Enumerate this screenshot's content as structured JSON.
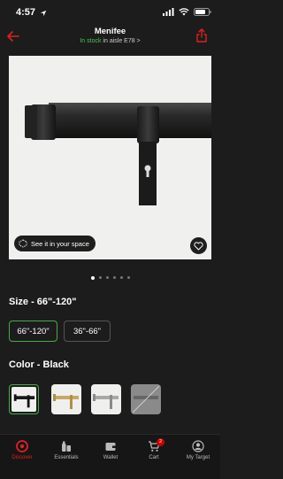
{
  "status_bar": {
    "time": "4:57"
  },
  "header": {
    "store_name": "Menifee",
    "stock_status": "In stock",
    "aisle": "in aisle E78 >"
  },
  "product_image": {
    "see_in_space_label": "See it in your space",
    "carousel_pages": 6,
    "active_page": 1
  },
  "size": {
    "title": "Size - 66\"-120\"",
    "options": [
      {
        "label": "66\"-120\"",
        "selected": true
      },
      {
        "label": "36\"-66\"",
        "selected": false
      }
    ]
  },
  "color": {
    "title": "Color - Black",
    "swatches": [
      {
        "name": "black",
        "selected": true
      },
      {
        "name": "gold",
        "selected": false
      },
      {
        "name": "silver",
        "selected": false
      },
      {
        "name": "gray-unavailable",
        "selected": false
      }
    ]
  },
  "tab_bar": {
    "tabs": [
      {
        "label": "Discover",
        "icon": "target-logo-icon",
        "active": true
      },
      {
        "label": "Essentials",
        "icon": "essentials-icon",
        "active": false
      },
      {
        "label": "Wallet",
        "icon": "wallet-icon",
        "active": false
      },
      {
        "label": "Cart",
        "icon": "cart-icon",
        "active": false
      },
      {
        "label": "My Target",
        "icon": "profile-icon",
        "active": false
      }
    ],
    "cart_count": "2"
  },
  "colors": {
    "accent_green": "#4aa84a",
    "target_red": "#e02020",
    "stock_green": "#4fc04f"
  }
}
